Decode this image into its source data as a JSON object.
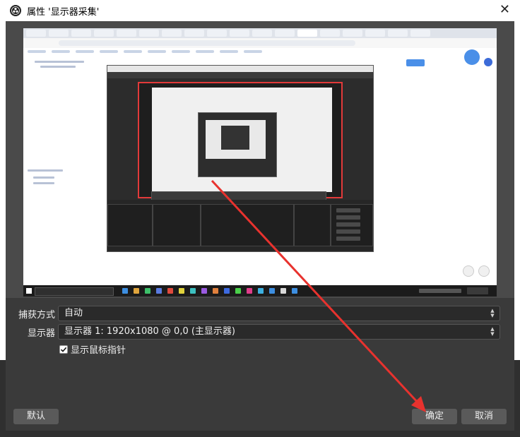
{
  "window": {
    "title": "属性 '显示器采集'",
    "close_glyph": "✕"
  },
  "form": {
    "capture_method_label": "捕获方式",
    "capture_method_value": "自动",
    "display_label": "显示器",
    "display_value": "显示器 1: 1920x1080 @ 0,0 (主显示器)",
    "show_cursor_label": "显示鼠标指针",
    "show_cursor_checked": true
  },
  "buttons": {
    "defaults_label": "默认",
    "ok_label": "确定",
    "cancel_label": "取消"
  },
  "colors": {
    "annotation_arrow": "#e8322e",
    "dialog_bg": "#3a3a3a",
    "selection_border": "#e23a3a"
  }
}
